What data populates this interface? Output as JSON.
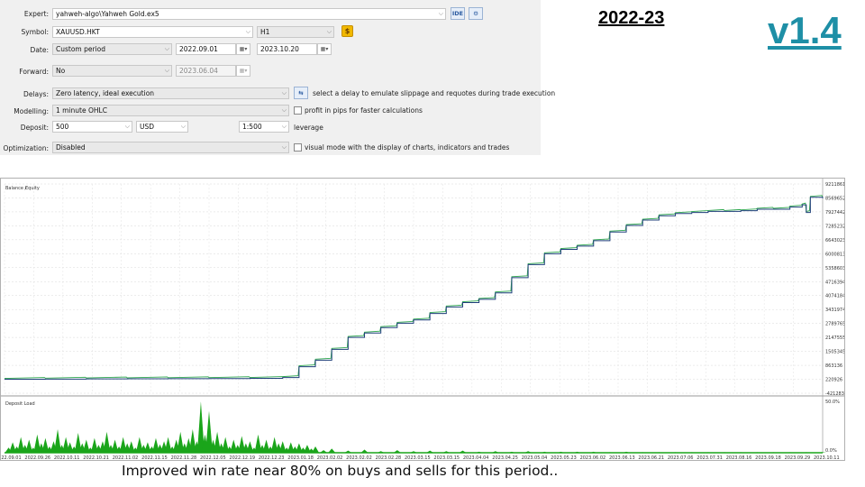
{
  "settings": {
    "expert": {
      "label": "Expert:",
      "value": "yahweh-algo\\Yahweh Gold.ex5",
      "ide_label": "IDE"
    },
    "symbol": {
      "label": "Symbol:",
      "value": "XAUUSD.HKT",
      "timeframe": "H1",
      "coin_glyph": "$"
    },
    "date": {
      "label": "Date:",
      "mode": "Custom period",
      "from": "2022.09.01",
      "to": "2023.10.20"
    },
    "forward": {
      "label": "Forward:",
      "mode": "No",
      "date": "2023.06.04"
    },
    "delays": {
      "label": "Delays:",
      "value": "Zero latency, ideal execution",
      "hint": "select a delay to emulate slippage and requotes during trade execution"
    },
    "modelling": {
      "label": "Modelling:",
      "value": "1 minute OHLC",
      "option": "profit in pips for faster calculations"
    },
    "deposit": {
      "label": "Deposit:",
      "value": "500",
      "currency": "USD",
      "leverage_value": "1:500",
      "leverage_label": "leverage"
    },
    "optimization": {
      "label": "Optimization:",
      "value": "Disabled",
      "option": "visual mode with the display of charts, indicators and trades"
    }
  },
  "heading": {
    "period": "2022-23",
    "version": "v1.4"
  },
  "caption": "Improved win rate near 80% on buys and sells for this period..",
  "colors": {
    "balance": "#1f3f7a",
    "equity": "#2fa84f",
    "load": "#1aa51a",
    "version": "#1e8fa6"
  },
  "chart_data": {
    "type": "line",
    "legend": [
      "Balance",
      "Equity"
    ],
    "y_ticks": [
      "9211861",
      "8569652",
      "7927442",
      "7285232",
      "6643023",
      "6000813",
      "5358603",
      "4716394",
      "4074184",
      "3431974",
      "2789765",
      "2147555",
      "1505345",
      "863136",
      "220926",
      "-421283"
    ],
    "x_ticks": [
      "2022.09.01",
      "2022.09.26",
      "2022.10.11",
      "2022.10.21",
      "2022.11.02",
      "2022.11.15",
      "2022.11.28",
      "2022.12.05",
      "2022.12.19",
      "2022.12.23",
      "2023.01.18",
      "2023.02.02",
      "2023.02.02",
      "2023.02.28",
      "2023.03.15",
      "2023.03.15",
      "2023.04.04",
      "2023.04.25",
      "2023.05.04",
      "2023.05.23",
      "2023.06.02",
      "2023.06.13",
      "2023.06.21",
      "2023.07.06",
      "2023.07.31",
      "2023.08.16",
      "2023.09.18",
      "2023.09.29",
      "2023.10.11"
    ],
    "x": [
      0,
      0.05,
      0.1,
      0.15,
      0.2,
      0.25,
      0.3,
      0.34,
      0.36,
      0.38,
      0.4,
      0.42,
      0.44,
      0.46,
      0.48,
      0.5,
      0.52,
      0.54,
      0.56,
      0.58,
      0.6,
      0.62,
      0.64,
      0.66,
      0.68,
      0.7,
      0.72,
      0.74,
      0.76,
      0.78,
      0.8,
      0.82,
      0.84,
      0.86,
      0.88,
      0.9,
      0.92,
      0.94,
      0.96,
      0.975,
      0.98,
      0.985,
      1.0
    ],
    "balance": [
      220000,
      230000,
      240000,
      245000,
      250000,
      255000,
      262000,
      300000,
      800000,
      1100000,
      1600000,
      2150000,
      2350000,
      2600000,
      2800000,
      2950000,
      3250000,
      3550000,
      3750000,
      3900000,
      4200000,
      4900000,
      5500000,
      6000000,
      6200000,
      6350000,
      6600000,
      7000000,
      7300000,
      7550000,
      7750000,
      7850000,
      7900000,
      7950000,
      7950000,
      7980000,
      8050000,
      8050000,
      8150000,
      8250000,
      7900000,
      8600000,
      8550000
    ],
    "ylim": [
      -421283,
      9211861
    ],
    "load": [
      [
        0.005,
        0.1
      ],
      [
        0.01,
        0.2
      ],
      [
        0.015,
        0.12
      ],
      [
        0.02,
        0.3
      ],
      [
        0.025,
        0.15
      ],
      [
        0.03,
        0.25
      ],
      [
        0.035,
        0.1
      ],
      [
        0.04,
        0.35
      ],
      [
        0.045,
        0.18
      ],
      [
        0.05,
        0.28
      ],
      [
        0.055,
        0.12
      ],
      [
        0.06,
        0.22
      ],
      [
        0.065,
        0.45
      ],
      [
        0.07,
        0.15
      ],
      [
        0.075,
        0.3
      ],
      [
        0.08,
        0.2
      ],
      [
        0.085,
        0.12
      ],
      [
        0.09,
        0.38
      ],
      [
        0.095,
        0.18
      ],
      [
        0.1,
        0.25
      ],
      [
        0.105,
        0.1
      ],
      [
        0.11,
        0.28
      ],
      [
        0.115,
        0.15
      ],
      [
        0.12,
        0.22
      ],
      [
        0.125,
        0.4
      ],
      [
        0.13,
        0.15
      ],
      [
        0.135,
        0.25
      ],
      [
        0.14,
        0.12
      ],
      [
        0.145,
        0.3
      ],
      [
        0.15,
        0.18
      ],
      [
        0.155,
        0.22
      ],
      [
        0.16,
        0.1
      ],
      [
        0.165,
        0.3
      ],
      [
        0.17,
        0.15
      ],
      [
        0.175,
        0.2
      ],
      [
        0.18,
        0.12
      ],
      [
        0.185,
        0.28
      ],
      [
        0.19,
        0.16
      ],
      [
        0.195,
        0.22
      ],
      [
        0.2,
        0.3
      ],
      [
        0.205,
        0.12
      ],
      [
        0.21,
        0.25
      ],
      [
        0.215,
        0.4
      ],
      [
        0.22,
        0.18
      ],
      [
        0.225,
        0.28
      ],
      [
        0.23,
        0.45
      ],
      [
        0.235,
        0.22
      ],
      [
        0.24,
        0.98
      ],
      [
        0.245,
        0.35
      ],
      [
        0.25,
        0.8
      ],
      [
        0.255,
        0.25
      ],
      [
        0.26,
        0.4
      ],
      [
        0.265,
        0.18
      ],
      [
        0.27,
        0.3
      ],
      [
        0.275,
        0.12
      ],
      [
        0.28,
        0.25
      ],
      [
        0.285,
        0.15
      ],
      [
        0.29,
        0.32
      ],
      [
        0.295,
        0.18
      ],
      [
        0.3,
        0.22
      ],
      [
        0.305,
        0.1
      ],
      [
        0.31,
        0.35
      ],
      [
        0.315,
        0.15
      ],
      [
        0.32,
        0.25
      ],
      [
        0.325,
        0.12
      ],
      [
        0.33,
        0.3
      ],
      [
        0.335,
        0.18
      ],
      [
        0.34,
        0.22
      ],
      [
        0.345,
        0.1
      ],
      [
        0.35,
        0.2
      ],
      [
        0.355,
        0.12
      ],
      [
        0.36,
        0.18
      ],
      [
        0.365,
        0.1
      ],
      [
        0.37,
        0.15
      ],
      [
        0.375,
        0.08
      ],
      [
        0.38,
        0.12
      ],
      [
        0.39,
        0.05
      ],
      [
        0.4,
        0.08
      ],
      [
        0.42,
        0.04
      ],
      [
        0.44,
        0.06
      ],
      [
        0.46,
        0.03
      ],
      [
        0.48,
        0.05
      ],
      [
        0.5,
        0.03
      ],
      [
        0.52,
        0.04
      ],
      [
        0.54,
        0.03
      ],
      [
        0.56,
        0.04
      ],
      [
        0.58,
        0.02
      ],
      [
        0.6,
        0.03
      ],
      [
        0.62,
        0.02
      ],
      [
        0.64,
        0.03
      ],
      [
        0.66,
        0.02
      ],
      [
        0.68,
        0.02
      ],
      [
        0.7,
        0.02
      ],
      [
        0.72,
        0.02
      ],
      [
        0.74,
        0.01
      ],
      [
        0.76,
        0.02
      ],
      [
        0.78,
        0.01
      ],
      [
        0.8,
        0.01
      ],
      [
        0.82,
        0.01
      ],
      [
        0.84,
        0.01
      ],
      [
        0.86,
        0.01
      ],
      [
        0.88,
        0.01
      ],
      [
        0.9,
        0.01
      ],
      [
        0.92,
        0.01
      ],
      [
        0.94,
        0.01
      ],
      [
        0.96,
        0.01
      ],
      [
        0.98,
        0.01
      ],
      [
        1.0,
        0.01
      ]
    ],
    "load_ticks": [
      "50.0%",
      "0.0%"
    ],
    "load_title": "Deposit Load"
  }
}
